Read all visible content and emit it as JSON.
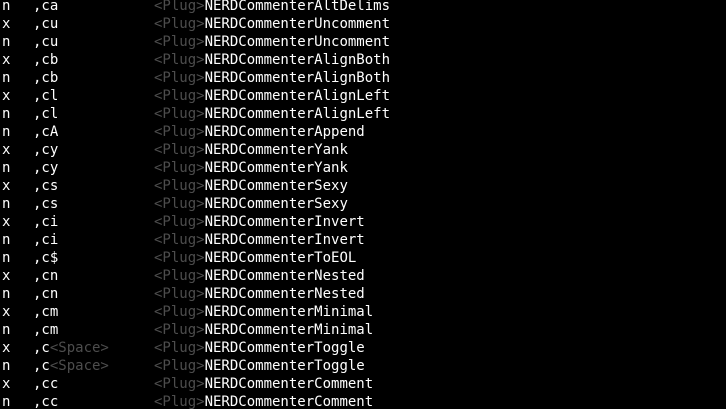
{
  "mappings": [
    {
      "mode": "n",
      "key": ",ca",
      "key_special": "",
      "plug": "<Plug>",
      "command": "NERDCommenterAltDelims"
    },
    {
      "mode": "x",
      "key": ",cu",
      "key_special": "",
      "plug": "<Plug>",
      "command": "NERDCommenterUncomment"
    },
    {
      "mode": "n",
      "key": ",cu",
      "key_special": "",
      "plug": "<Plug>",
      "command": "NERDCommenterUncomment"
    },
    {
      "mode": "x",
      "key": ",cb",
      "key_special": "",
      "plug": "<Plug>",
      "command": "NERDCommenterAlignBoth"
    },
    {
      "mode": "n",
      "key": ",cb",
      "key_special": "",
      "plug": "<Plug>",
      "command": "NERDCommenterAlignBoth"
    },
    {
      "mode": "x",
      "key": ",cl",
      "key_special": "",
      "plug": "<Plug>",
      "command": "NERDCommenterAlignLeft"
    },
    {
      "mode": "n",
      "key": ",cl",
      "key_special": "",
      "plug": "<Plug>",
      "command": "NERDCommenterAlignLeft"
    },
    {
      "mode": "n",
      "key": ",cA",
      "key_special": "",
      "plug": "<Plug>",
      "command": "NERDCommenterAppend"
    },
    {
      "mode": "x",
      "key": ",cy",
      "key_special": "",
      "plug": "<Plug>",
      "command": "NERDCommenterYank"
    },
    {
      "mode": "n",
      "key": ",cy",
      "key_special": "",
      "plug": "<Plug>",
      "command": "NERDCommenterYank"
    },
    {
      "mode": "x",
      "key": ",cs",
      "key_special": "",
      "plug": "<Plug>",
      "command": "NERDCommenterSexy"
    },
    {
      "mode": "n",
      "key": ",cs",
      "key_special": "",
      "plug": "<Plug>",
      "command": "NERDCommenterSexy"
    },
    {
      "mode": "x",
      "key": ",ci",
      "key_special": "",
      "plug": "<Plug>",
      "command": "NERDCommenterInvert"
    },
    {
      "mode": "n",
      "key": ",ci",
      "key_special": "",
      "plug": "<Plug>",
      "command": "NERDCommenterInvert"
    },
    {
      "mode": "n",
      "key": ",c$",
      "key_special": "",
      "plug": "<Plug>",
      "command": "NERDCommenterToEOL"
    },
    {
      "mode": "x",
      "key": ",cn",
      "key_special": "",
      "plug": "<Plug>",
      "command": "NERDCommenterNested"
    },
    {
      "mode": "n",
      "key": ",cn",
      "key_special": "",
      "plug": "<Plug>",
      "command": "NERDCommenterNested"
    },
    {
      "mode": "x",
      "key": ",cm",
      "key_special": "",
      "plug": "<Plug>",
      "command": "NERDCommenterMinimal"
    },
    {
      "mode": "n",
      "key": ",cm",
      "key_special": "",
      "plug": "<Plug>",
      "command": "NERDCommenterMinimal"
    },
    {
      "mode": "x",
      "key": ",c",
      "key_special": "<Space>",
      "plug": "<Plug>",
      "command": "NERDCommenterToggle"
    },
    {
      "mode": "n",
      "key": ",c",
      "key_special": "<Space>",
      "plug": "<Plug>",
      "command": "NERDCommenterToggle"
    },
    {
      "mode": "x",
      "key": ",cc",
      "key_special": "",
      "plug": "<Plug>",
      "command": "NERDCommenterComment"
    },
    {
      "mode": "n",
      "key": ",cc",
      "key_special": "",
      "plug": "<Plug>",
      "command": "NERDCommenterComment"
    }
  ],
  "colors": {
    "background": "#000000",
    "text": "#ffffff",
    "special_key": "#4d4d4d"
  }
}
